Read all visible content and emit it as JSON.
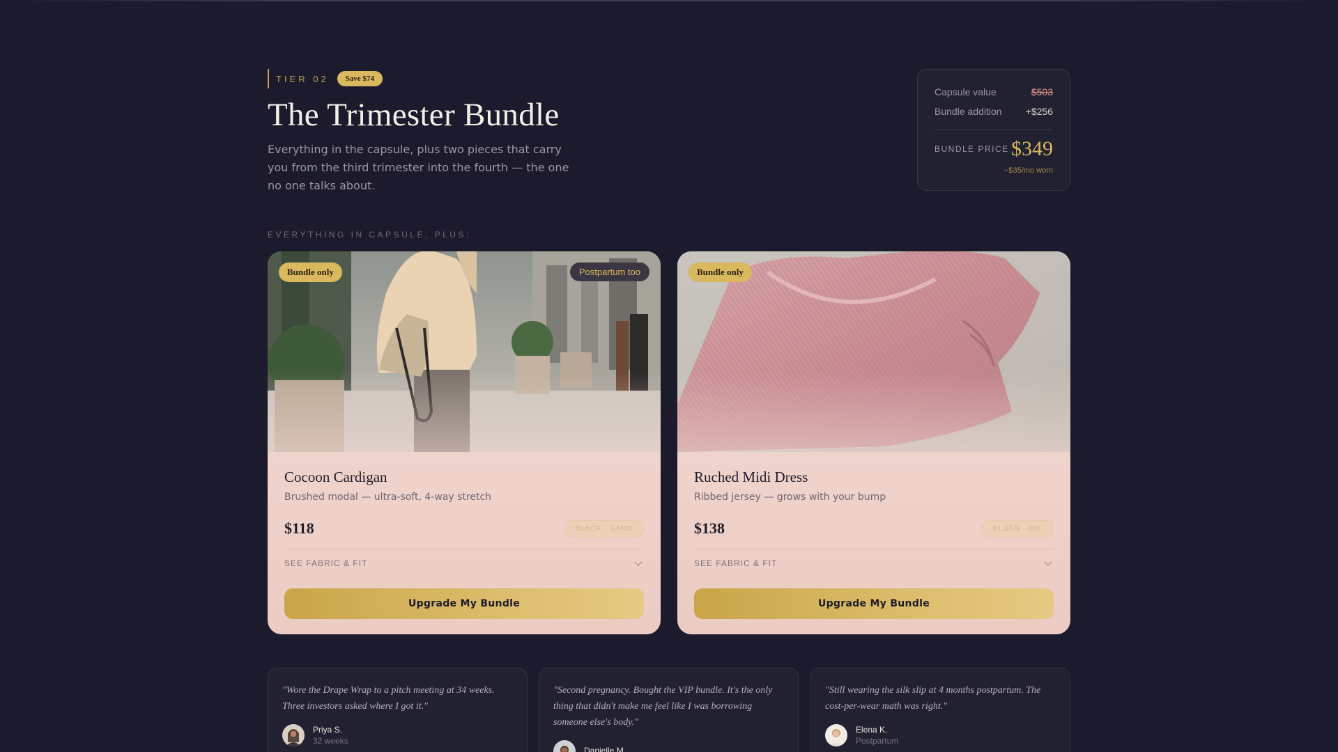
{
  "header": {
    "tier_label": "TIER 02",
    "save_badge": "Save $74",
    "title": "The Trimester Bundle",
    "subtitle": "Everything in the capsule, plus two pieces that carry you from the third trimester into the fourth — the one no one talks about."
  },
  "price_box": {
    "capsule_label": "Capsule value",
    "capsule_value": "$503",
    "addition_label": "Bundle addition",
    "addition_value": "+$256",
    "bundle_label": "BUNDLE PRICE",
    "bundle_price": "$349",
    "per_month": "~$35/mo worn"
  },
  "section_label": "EVERYTHING IN CAPSULE, PLUS:",
  "products": [
    {
      "badge": "Bundle only",
      "extra_badge": "Postpartum too",
      "name": "Cocoon Cardigan",
      "desc": "Brushed modal — ultra-soft, 4-way stretch",
      "price": "$118",
      "pill": "BLACK · SAND",
      "fabric_label": "SEE FABRIC & FIT",
      "button": "Upgrade My Bundle"
    },
    {
      "badge": "Bundle only",
      "name": "Ruched Midi Dress",
      "desc": "Ribbed jersey — grows with your bump",
      "price": "$138",
      "pill": "BLUSH · INK",
      "fabric_label": "SEE FABRIC & FIT",
      "button": "Upgrade My Bundle"
    }
  ],
  "testimonials": [
    {
      "quote": "\"Wore the Drape Wrap to a pitch meeting at 34 weeks. Three investors asked where I got it.\"",
      "name": "Priya S.",
      "meta": "32 weeks"
    },
    {
      "quote": "\"Second pregnancy. Bought the VIP bundle. It's the only thing that didn't make me feel like I was borrowing someone else's body.\"",
      "name": "Danielle M.",
      "meta": ""
    },
    {
      "quote": "\"Still wearing the silk slip at 4 months postpartum. The cost-per-wear math was right.\"",
      "name": "Elena K.",
      "meta": "Postpartum"
    }
  ],
  "colors": {
    "background": "#1b1b2d",
    "gold": "#d9b85e",
    "card": "#f1d9d2"
  }
}
